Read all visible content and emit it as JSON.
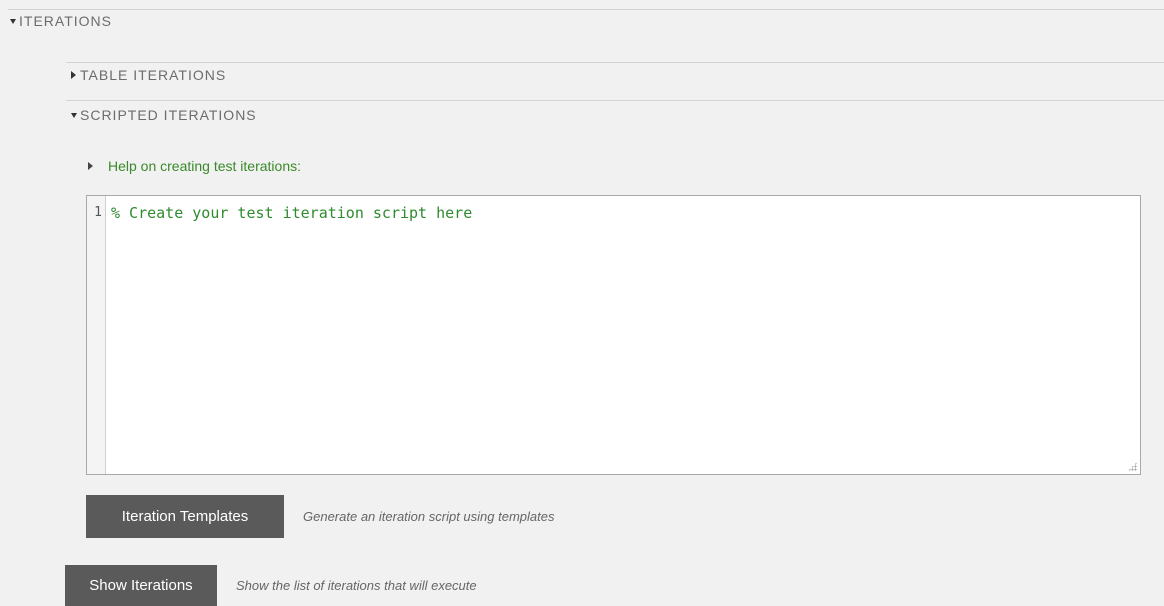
{
  "iterations": {
    "header": "ITERATIONS",
    "table_iterations": {
      "header": "TABLE ITERATIONS"
    },
    "scripted_iterations": {
      "header": "SCRIPTED ITERATIONS",
      "help_link": "Help on creating test iterations:",
      "editor": {
        "line_number": "1",
        "code": "% Create your test iteration script here"
      },
      "templates_button": "Iteration Templates",
      "templates_hint": "Generate an iteration script using templates"
    },
    "show_button": "Show Iterations",
    "show_hint": "Show the list of iterations that will execute"
  },
  "colors": {
    "help_text": "#3a8a2a",
    "code_comment": "#2e8b2e",
    "button_bg": "#5a5a5a"
  }
}
